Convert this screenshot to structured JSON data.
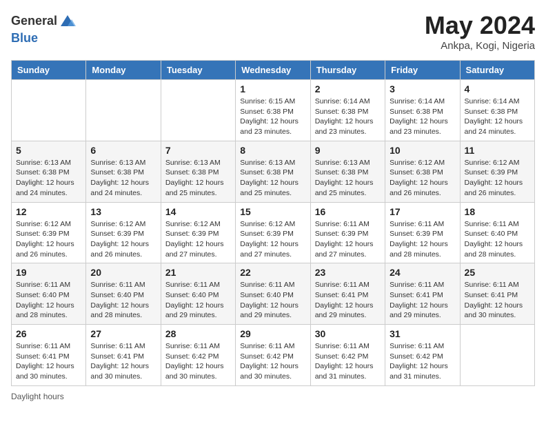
{
  "header": {
    "logo_line1": "General",
    "logo_line2": "Blue",
    "month_title": "May 2024",
    "location": "Ankpa, Kogi, Nigeria"
  },
  "weekdays": [
    "Sunday",
    "Monday",
    "Tuesday",
    "Wednesday",
    "Thursday",
    "Friday",
    "Saturday"
  ],
  "weeks": [
    [
      {
        "day": "",
        "info": ""
      },
      {
        "day": "",
        "info": ""
      },
      {
        "day": "",
        "info": ""
      },
      {
        "day": "1",
        "info": "Sunrise: 6:15 AM\nSunset: 6:38 PM\nDaylight: 12 hours and 23 minutes."
      },
      {
        "day": "2",
        "info": "Sunrise: 6:14 AM\nSunset: 6:38 PM\nDaylight: 12 hours and 23 minutes."
      },
      {
        "day": "3",
        "info": "Sunrise: 6:14 AM\nSunset: 6:38 PM\nDaylight: 12 hours and 23 minutes."
      },
      {
        "day": "4",
        "info": "Sunrise: 6:14 AM\nSunset: 6:38 PM\nDaylight: 12 hours and 24 minutes."
      }
    ],
    [
      {
        "day": "5",
        "info": "Sunrise: 6:13 AM\nSunset: 6:38 PM\nDaylight: 12 hours and 24 minutes."
      },
      {
        "day": "6",
        "info": "Sunrise: 6:13 AM\nSunset: 6:38 PM\nDaylight: 12 hours and 24 minutes."
      },
      {
        "day": "7",
        "info": "Sunrise: 6:13 AM\nSunset: 6:38 PM\nDaylight: 12 hours and 25 minutes."
      },
      {
        "day": "8",
        "info": "Sunrise: 6:13 AM\nSunset: 6:38 PM\nDaylight: 12 hours and 25 minutes."
      },
      {
        "day": "9",
        "info": "Sunrise: 6:13 AM\nSunset: 6:38 PM\nDaylight: 12 hours and 25 minutes."
      },
      {
        "day": "10",
        "info": "Sunrise: 6:12 AM\nSunset: 6:38 PM\nDaylight: 12 hours and 26 minutes."
      },
      {
        "day": "11",
        "info": "Sunrise: 6:12 AM\nSunset: 6:39 PM\nDaylight: 12 hours and 26 minutes."
      }
    ],
    [
      {
        "day": "12",
        "info": "Sunrise: 6:12 AM\nSunset: 6:39 PM\nDaylight: 12 hours and 26 minutes."
      },
      {
        "day": "13",
        "info": "Sunrise: 6:12 AM\nSunset: 6:39 PM\nDaylight: 12 hours and 26 minutes."
      },
      {
        "day": "14",
        "info": "Sunrise: 6:12 AM\nSunset: 6:39 PM\nDaylight: 12 hours and 27 minutes."
      },
      {
        "day": "15",
        "info": "Sunrise: 6:12 AM\nSunset: 6:39 PM\nDaylight: 12 hours and 27 minutes."
      },
      {
        "day": "16",
        "info": "Sunrise: 6:11 AM\nSunset: 6:39 PM\nDaylight: 12 hours and 27 minutes."
      },
      {
        "day": "17",
        "info": "Sunrise: 6:11 AM\nSunset: 6:39 PM\nDaylight: 12 hours and 28 minutes."
      },
      {
        "day": "18",
        "info": "Sunrise: 6:11 AM\nSunset: 6:40 PM\nDaylight: 12 hours and 28 minutes."
      }
    ],
    [
      {
        "day": "19",
        "info": "Sunrise: 6:11 AM\nSunset: 6:40 PM\nDaylight: 12 hours and 28 minutes."
      },
      {
        "day": "20",
        "info": "Sunrise: 6:11 AM\nSunset: 6:40 PM\nDaylight: 12 hours and 28 minutes."
      },
      {
        "day": "21",
        "info": "Sunrise: 6:11 AM\nSunset: 6:40 PM\nDaylight: 12 hours and 29 minutes."
      },
      {
        "day": "22",
        "info": "Sunrise: 6:11 AM\nSunset: 6:40 PM\nDaylight: 12 hours and 29 minutes."
      },
      {
        "day": "23",
        "info": "Sunrise: 6:11 AM\nSunset: 6:41 PM\nDaylight: 12 hours and 29 minutes."
      },
      {
        "day": "24",
        "info": "Sunrise: 6:11 AM\nSunset: 6:41 PM\nDaylight: 12 hours and 29 minutes."
      },
      {
        "day": "25",
        "info": "Sunrise: 6:11 AM\nSunset: 6:41 PM\nDaylight: 12 hours and 30 minutes."
      }
    ],
    [
      {
        "day": "26",
        "info": "Sunrise: 6:11 AM\nSunset: 6:41 PM\nDaylight: 12 hours and 30 minutes."
      },
      {
        "day": "27",
        "info": "Sunrise: 6:11 AM\nSunset: 6:41 PM\nDaylight: 12 hours and 30 minutes."
      },
      {
        "day": "28",
        "info": "Sunrise: 6:11 AM\nSunset: 6:42 PM\nDaylight: 12 hours and 30 minutes."
      },
      {
        "day": "29",
        "info": "Sunrise: 6:11 AM\nSunset: 6:42 PM\nDaylight: 12 hours and 30 minutes."
      },
      {
        "day": "30",
        "info": "Sunrise: 6:11 AM\nSunset: 6:42 PM\nDaylight: 12 hours and 31 minutes."
      },
      {
        "day": "31",
        "info": "Sunrise: 6:11 AM\nSunset: 6:42 PM\nDaylight: 12 hours and 31 minutes."
      },
      {
        "day": "",
        "info": ""
      }
    ]
  ],
  "footer": {
    "daylight_label": "Daylight hours"
  }
}
